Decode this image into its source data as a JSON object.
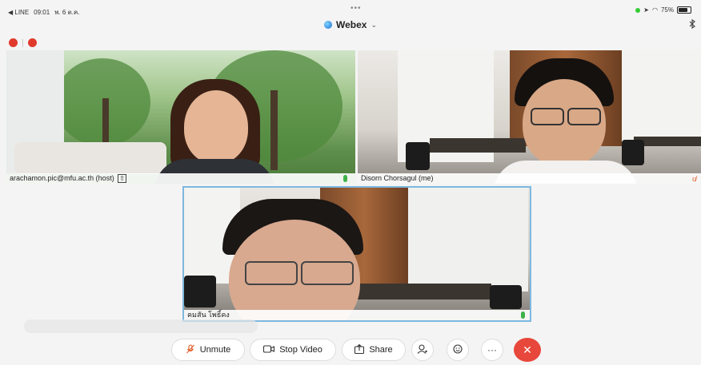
{
  "status_bar": {
    "back_app": "◀ LINE",
    "time": "09:01",
    "date": "พ. 6 ต.ค.",
    "dots": "•••",
    "battery": "75%",
    "battery_level": 0.75
  },
  "title_bar": {
    "app_name": "Webex",
    "chevron": "⌄",
    "bluetooth_icon": "bluetooth-icon"
  },
  "video_tiles": [
    {
      "name": "arachamon.pic@mfu.ac.th (host)",
      "share_badge": "⇧",
      "audio": "on"
    },
    {
      "name": "Disorn Chorsagul (me)",
      "audio": "muted"
    },
    {
      "name": "คมสัน โพธิ์คง",
      "audio": "on"
    }
  ],
  "controls": {
    "unmute_label": "Unmute",
    "stop_video_label": "Stop Video",
    "share_label": "Share",
    "participants_icon": "participants-icon",
    "reactions_icon": "reactions-icon",
    "more_label": "···",
    "end_icon": "✕"
  },
  "colors": {
    "end_button": "#e8473b",
    "active_speaker_border": "#7db8e0",
    "mic_on": "#3db24a",
    "mic_muted": "#e25c2a"
  }
}
